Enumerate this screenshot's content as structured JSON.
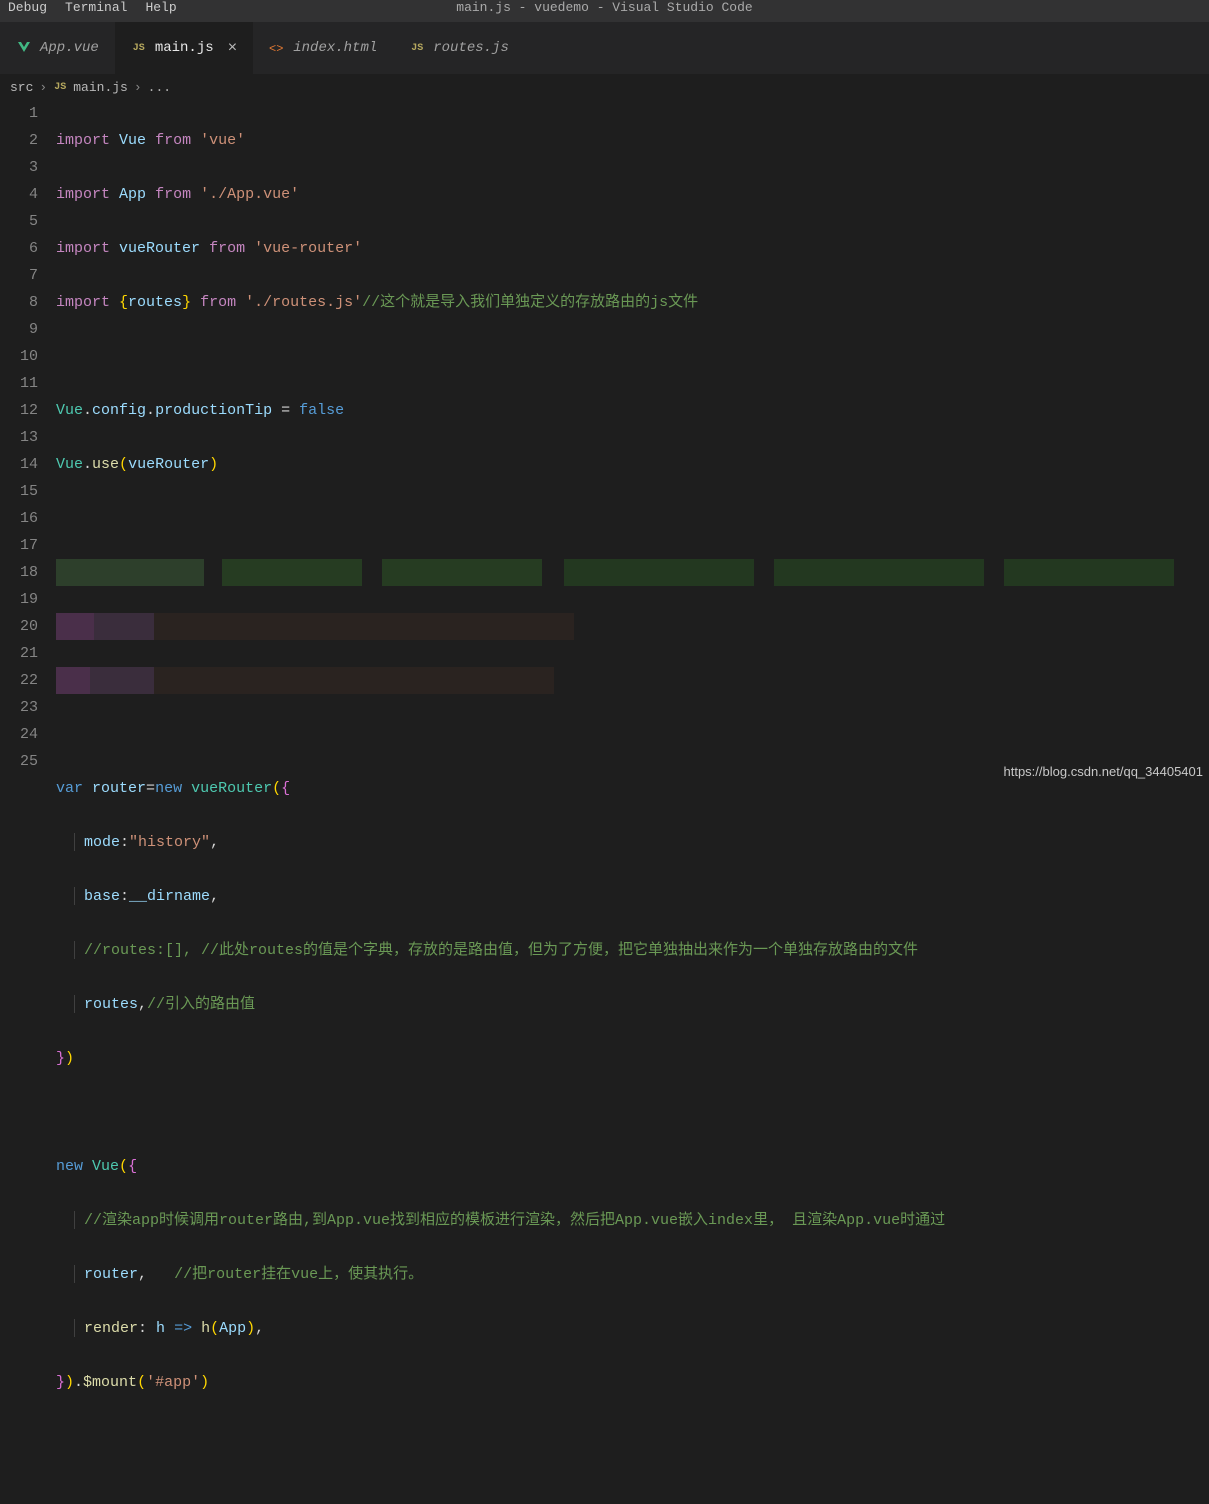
{
  "window": {
    "title": "main.js - vuedemo - Visual Studio Code"
  },
  "menu": {
    "debug": "Debug",
    "terminal": "Terminal",
    "help": "Help"
  },
  "tabs": {
    "t1": {
      "label": "App.vue",
      "icon": "vue"
    },
    "t2": {
      "label": "main.js",
      "icon": "js",
      "active": true,
      "close": "×"
    },
    "t3": {
      "label": "index.html",
      "icon": "html"
    },
    "t4": {
      "label": "routes.js",
      "icon": "js"
    }
  },
  "breadcrumbs": {
    "seg1": "src",
    "seg2": "main.js",
    "ellipsis": "..."
  },
  "gutter": [
    "1",
    "2",
    "3",
    "4",
    "5",
    "6",
    "7",
    "8",
    "9",
    "10",
    "11",
    "12",
    "13",
    "14",
    "15",
    "16",
    "17",
    "18",
    "19",
    "20",
    "21",
    "22",
    "23",
    "24",
    "25"
  ],
  "code": {
    "l1": {
      "import": "import",
      "vue": "Vue",
      "from": "from",
      "str": "'vue'"
    },
    "l2": {
      "import": "import",
      "app": "App",
      "from": "from",
      "str": "'./App.vue'"
    },
    "l3": {
      "import": "import",
      "vr": "vueRouter",
      "from": "from",
      "str": "'vue-router'"
    },
    "l4": {
      "import": "import",
      "lb": "{",
      "routes": "routes",
      "rb": "}",
      "from": "from",
      "str": "'./routes.js'",
      "com": "//这个就是导入我们单独定义的存放路由的js文件"
    },
    "l6": {
      "vue": "Vue",
      "dot1": ".",
      "config": "config",
      "dot2": ".",
      "ptip": "productionTip",
      "eq": " = ",
      "false": "false"
    },
    "l7": {
      "vue": "Vue",
      "dot1": ".",
      "use": "use",
      "lp": "(",
      "vr": "vueRouter",
      "rp": ")"
    },
    "l13": {
      "var": "var",
      "router": "router",
      "eq": "=",
      "new": "new",
      "vr": "vueRouter",
      "lp": "(",
      "lb": "{"
    },
    "l14": {
      "mode": "mode",
      "colon": ":",
      "str": "\"history\"",
      "comma": ","
    },
    "l15": {
      "base": "base",
      "colon": ":",
      "dirname": "__dirname",
      "comma": ","
    },
    "l16": {
      "com": "//routes:[], //此处routes的值是个字典，存放的是路由值，但为了方便，把它单独抽出来作为一个单独存放路由的文件"
    },
    "l17": {
      "routes": "routes",
      "comma": ",",
      "com": "//引入的路由值"
    },
    "l18": {
      "rb": "}",
      "rp": ")"
    },
    "l20": {
      "new": "new",
      "vue": "Vue",
      "lp": "(",
      "lb": "{"
    },
    "l21": {
      "com": "//渲染app时候调用router路由,到App.vue找到相应的模板进行渲染，然后把App.vue嵌入index里， 且渲染App.vue时通过"
    },
    "l22": {
      "router": "router",
      "comma": ",",
      "com": "//把router挂在vue上，使其执行。"
    },
    "l23": {
      "render": "render",
      "colon": ": ",
      "h": "h",
      "arrow": " => ",
      "h2": "h",
      "lp": "(",
      "app": "App",
      "rp": ")",
      "comma": ","
    },
    "l24": {
      "rb": "}",
      "rp": ")",
      "dot": ".",
      "mount": "$mount",
      "lp2": "(",
      "str": "'#app'",
      "rp2": ")"
    }
  },
  "watermark": "https://blog.csdn.net/qq_34405401"
}
